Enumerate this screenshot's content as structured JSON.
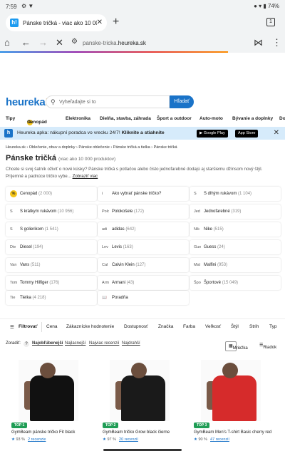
{
  "status": {
    "time": "7:59",
    "notif": "⚙ ▼",
    "right": "● ▾ ▮ 74%"
  },
  "tab": {
    "title": "Pánske tričká - viac ako 10 00",
    "count": "1",
    "favicon": "h!"
  },
  "urlbar": {
    "url_prefix": "panske-tricka.",
    "url_domain": "heureka.sk"
  },
  "site": {
    "logo": "heureka",
    "logo_bang": "!",
    "search_placeholder": "Vyheľadajte si to",
    "search_button": "Hľadať"
  },
  "nav": [
    "Tipy",
    "Cenopád",
    "Elektronika",
    "Dielňa, stavba, záhrada",
    "Šport a outdoor",
    "Auto-moto",
    "Bývanie a doplnky",
    "Do"
  ],
  "banner": {
    "text": "Heureka apka: nákupní poradca vo vrecku 24/7!",
    "cta": "Kliknite a stiahnite",
    "google": "▶ Google Play",
    "apple": " App Store"
  },
  "breadcrumb": "Heureka.sk  ›  Oblečenie, obuv a doplnky  ›  Pánske oblečenie  ›  Pánske tričká a tielka  ›  Pánske tričká",
  "page": {
    "title": "Pánske tričká",
    "count": "(viac ako 10 000 produktov)",
    "description": "Chcete si svoj šatník oživiť o nové kúsky? Pánske tričká s potlačou alebo čisto jednofarebné dodajú aj staršiemu džínsom nový štýl. Príjemné a padnúce tričko vybe...",
    "more": "Zobraziť viac"
  },
  "tiles": [
    [
      {
        "icon": "%",
        "label": "Cenopád",
        "count": "(2 000)"
      },
      {
        "icon": "i",
        "label": "Ako vybrať pánske tričko?",
        "count": ""
      },
      {
        "icon": "S",
        "label": "S dlhým rukávom",
        "count": "(1 104)"
      }
    ],
    [
      {
        "icon": "S",
        "label": "S krátkym rukávom",
        "count": "(10 956)"
      },
      {
        "icon": "Polo",
        "label": "Polokošele",
        "count": "(172)"
      },
      {
        "icon": "Jed",
        "label": "Jednofarebné",
        "count": "(319)"
      }
    ],
    [
      {
        "icon": "S",
        "label": "S golierikom",
        "count": "(1 541)"
      },
      {
        "icon": "adi",
        "label": "adidas",
        "count": "(642)"
      },
      {
        "icon": "Nik",
        "label": "Nike",
        "count": "(515)"
      }
    ],
    [
      {
        "icon": "Die",
        "label": "Diesel",
        "count": "(194)"
      },
      {
        "icon": "Lev",
        "label": "Levis",
        "count": "(163)"
      },
      {
        "icon": "Gue",
        "label": "Guess",
        "count": "(24)"
      }
    ],
    [
      {
        "icon": "Van",
        "label": "Vans",
        "count": "(511)"
      },
      {
        "icon": "Cal",
        "label": "Calvin Klein",
        "count": "(127)"
      },
      {
        "icon": "Mal",
        "label": "Malfini",
        "count": "(953)"
      }
    ],
    [
      {
        "icon": "Tom",
        "label": "Tommy Hilfiger",
        "count": "(176)"
      },
      {
        "icon": "Arm",
        "label": "Armani",
        "count": "(43)"
      },
      {
        "icon": "Špo",
        "label": "Športové",
        "count": "(15 049)"
      }
    ],
    [
      {
        "icon": "Tie",
        "label": "Tielka",
        "count": "(4 218)"
      },
      {
        "icon": "📖",
        "label": "Poradňa",
        "count": ""
      }
    ]
  ],
  "filters": {
    "label": "Filtrovať",
    "items": [
      "Cena",
      "Zákaznícke hodnotenie",
      "Dostupnosť",
      "Značka",
      "Farba",
      "Veľkosť",
      "Štýl",
      "Strih",
      "Typ"
    ]
  },
  "sort": {
    "label": "Zoradiť:",
    "help": "?",
    "options": [
      "Najobľúbenejší",
      "Najlacnejší",
      "Najviac recenzií",
      "Najdrahší"
    ],
    "view_grid": "Mriežka",
    "view_list": "Riadok"
  },
  "products": [
    {
      "badge": "TOP 1",
      "name": "GymBeam pánske tričko Fit black",
      "rating": "93 %",
      "reviews": "2 recenzie",
      "shirt_color": "#111111"
    },
    {
      "badge": "TOP 2",
      "name": "GymBeam tričko Grow black čierne",
      "rating": "97 %",
      "reviews": "20 recenzií",
      "shirt_color": "#1a1a1a"
    },
    {
      "badge": "TOP 3",
      "name": "GymBeam Men's T-shirt Basic cherry red",
      "rating": "90 %",
      "reviews": "47 recenzií",
      "shirt_color": "#d62b2b"
    }
  ],
  "colors": {
    "brand": "#1a73c8",
    "accent": "#f5a623",
    "banner_bg": "#d6ebfb",
    "top_badge": "#1f9d55"
  }
}
